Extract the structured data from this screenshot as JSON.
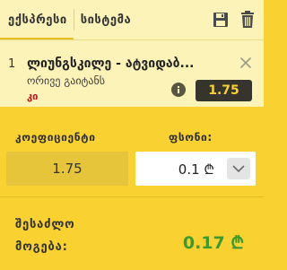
{
  "tabs": [
    {
      "label": "ექსპრესი"
    },
    {
      "label": "სისტემა"
    }
  ],
  "toolbar": {
    "save_icon": "save-icon",
    "trash_icon": "trash-icon"
  },
  "bet": {
    "index": "1",
    "title": "ლიუნგსკილე - ატვიდაბ...",
    "market": "ორივე გაიტანს",
    "selection": "კი",
    "odd": "1.75"
  },
  "coefficient": {
    "label": "კოეფიციენტი",
    "value": "1.75"
  },
  "stake": {
    "label": "ფსონი:",
    "value": "0.1 ₾"
  },
  "potential_win": {
    "label": "შესაძლო მოგება:",
    "value": "0.17 ₾"
  },
  "colors": {
    "accent": "#f9d231",
    "odd_badge_bg": "#35352e",
    "win_text": "#3c9b2f",
    "selection_text": "#c0121c"
  }
}
